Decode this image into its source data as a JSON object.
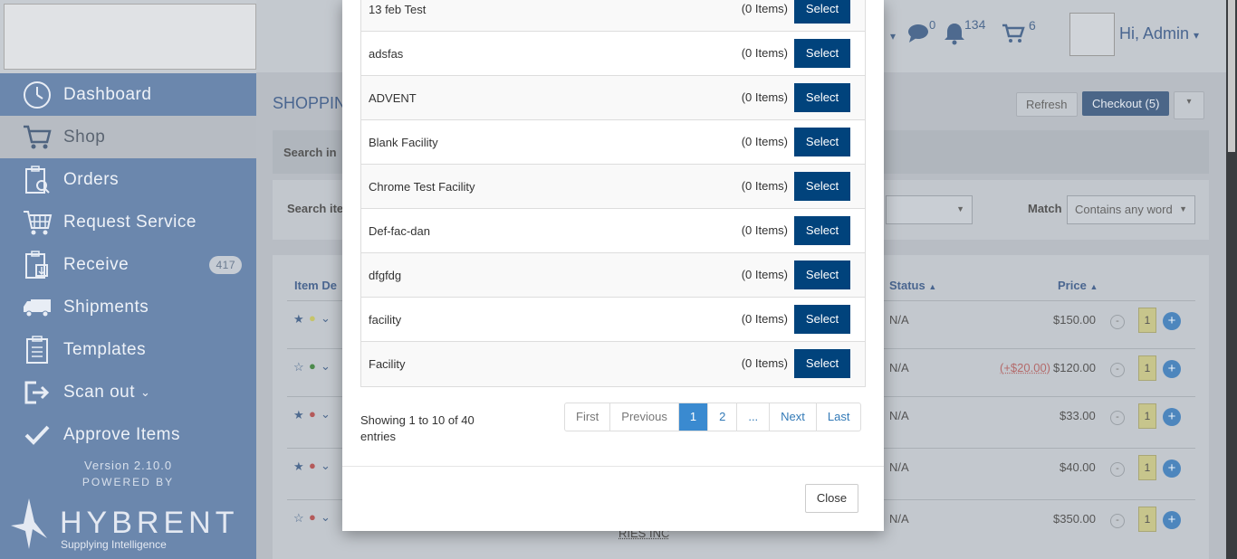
{
  "sidebar": {
    "nav": [
      {
        "label": "Dashboard",
        "icon": "clock-icon"
      },
      {
        "label": "Shop",
        "icon": "cart-icon"
      },
      {
        "label": "Orders",
        "icon": "clipboard-search-icon"
      },
      {
        "label": "Request Service",
        "icon": "cart-grid-icon"
      },
      {
        "label": "Receive",
        "icon": "clipboard-download-icon",
        "badge": "417"
      },
      {
        "label": "Shipments",
        "icon": "truck-icon"
      },
      {
        "label": "Templates",
        "icon": "clipboard-icon"
      },
      {
        "label": "Scan out",
        "icon": "logout-icon"
      },
      {
        "label": "Approve Items",
        "icon": "check-icon"
      }
    ],
    "version": "Version 2.10.0",
    "powered_by": "POWERED BY",
    "brand": "HYBRENT",
    "brand_tagline": "Supplying Intelligence"
  },
  "topbar": {
    "messages_count": "0",
    "notifications_count": "134",
    "cart_count": "6",
    "greeting": "Hi, Admin"
  },
  "page": {
    "title": "SHOPPIN",
    "refresh_label": "Refresh",
    "checkout_label": "Checkout (5)",
    "search_in_label": "Search in",
    "search_items_label": "Search ite",
    "match_label": "Match",
    "match_value": "Contains any word"
  },
  "table": {
    "headers": {
      "item": "Item De",
      "status": "Status",
      "price": "Price"
    },
    "rows": [
      {
        "status": "N/A",
        "price": "$150.00",
        "extra": "",
        "qty": "1"
      },
      {
        "status": "N/A",
        "price": "$120.00",
        "extra": "(+$20.00)",
        "qty": "1"
      },
      {
        "status": "N/A",
        "price": "$33.00",
        "extra": "",
        "qty": "1"
      },
      {
        "status": "N/A",
        "price": "$40.00",
        "extra": "",
        "qty": "1"
      },
      {
        "status": "N/A",
        "price": "$350.00",
        "extra": "",
        "qty": "1"
      }
    ],
    "vendor_fragment": "RIES INC"
  },
  "modal": {
    "facilities": [
      {
        "name": "13 feb Test",
        "count": "(0 Items)"
      },
      {
        "name": "adsfas",
        "count": "(0 Items)"
      },
      {
        "name": "ADVENT",
        "count": "(0 Items)"
      },
      {
        "name": "Blank Facility",
        "count": "(0 Items)"
      },
      {
        "name": "Chrome Test Facility",
        "count": "(0 Items)"
      },
      {
        "name": "Def-fac-dan",
        "count": "(0 Items)"
      },
      {
        "name": "dfgfdg",
        "count": "(0 Items)"
      },
      {
        "name": "facility",
        "count": "(0 Items)"
      },
      {
        "name": "Facility",
        "count": "(0 Items)"
      }
    ],
    "select_label": "Select",
    "showing": "Showing 1 to 10 of 40 entries",
    "pagination": [
      "First",
      "Previous",
      "1",
      "2",
      "...",
      "Next",
      "Last"
    ],
    "active_page": "1",
    "close_label": "Close"
  },
  "colors": {
    "select_button": "#01437c",
    "active_page": "#3a8ad0",
    "sidebar_nav": "#6b87ad"
  }
}
